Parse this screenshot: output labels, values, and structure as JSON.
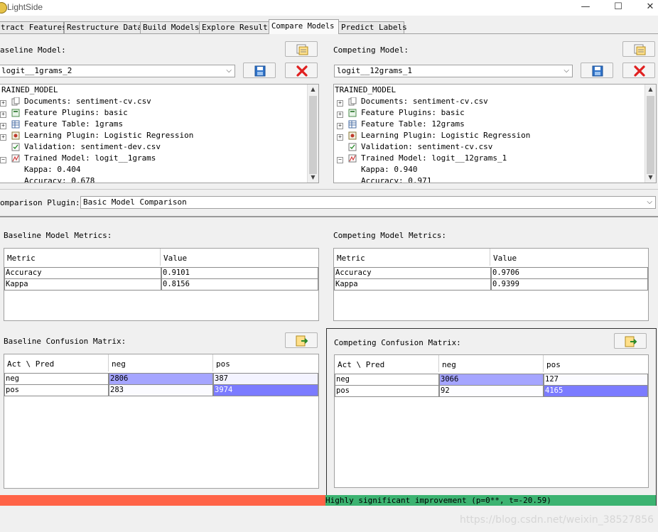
{
  "app": {
    "title": "LightSide"
  },
  "window_controls": {
    "minimize": "—",
    "maximize": "☐",
    "close": "✕"
  },
  "tabs": [
    {
      "label": "tract Features"
    },
    {
      "label": "Restructure Data"
    },
    {
      "label": "Build Models"
    },
    {
      "label": "Explore Results"
    },
    {
      "label": "Compare Models",
      "active": true
    },
    {
      "label": "Predict Labels"
    }
  ],
  "baseline": {
    "label": "aseline Model:",
    "selected_model": "logit__1grams_2",
    "tree": {
      "root": "RAINED_MODEL",
      "items": [
        {
          "text": "Documents: sentiment-cv.csv",
          "icon": "documents-icon"
        },
        {
          "text": "Feature Plugins: basic",
          "icon": "feature-plugins-icon"
        },
        {
          "text": "Feature Table: 1grams",
          "icon": "feature-table-icon"
        },
        {
          "text": "Learning Plugin:  Logistic Regression",
          "icon": "learning-plugin-icon"
        },
        {
          "text": "Validation: sentiment-dev.csv",
          "icon": "validation-icon"
        },
        {
          "text": "Trained Model: logit__1grams",
          "icon": "trained-model-icon"
        }
      ],
      "children": [
        "Kappa: 0.404",
        "Accuracy: 0.678"
      ]
    },
    "metrics_label": "Baseline Model Metrics:",
    "metrics_headers": [
      "Metric",
      "Value"
    ],
    "metrics": [
      {
        "name": "Accuracy",
        "value": "0.9101"
      },
      {
        "name": "Kappa",
        "value": "0.8156"
      }
    ],
    "confusion_label": "Baseline Confusion Matrix:",
    "confusion_headers": [
      "Act \\ Pred",
      "neg",
      "pos"
    ],
    "confusion": [
      {
        "act": "neg",
        "neg": "2806",
        "pos": "387"
      },
      {
        "act": "pos",
        "neg": "283",
        "pos": "3974"
      }
    ]
  },
  "competing": {
    "label": "Competing Model:",
    "selected_model": "logit__12grams_1",
    "tree": {
      "root": "TRAINED_MODEL",
      "items": [
        {
          "text": "Documents: sentiment-cv.csv",
          "icon": "documents-icon"
        },
        {
          "text": "Feature Plugins: basic",
          "icon": "feature-plugins-icon"
        },
        {
          "text": "Feature Table: 12grams",
          "icon": "feature-table-icon"
        },
        {
          "text": "Learning Plugin:  Logistic Regression",
          "icon": "learning-plugin-icon"
        },
        {
          "text": "Validation: sentiment-cv.csv",
          "icon": "validation-icon"
        },
        {
          "text": "Trained Model: logit__12grams_1",
          "icon": "trained-model-icon"
        }
      ],
      "children": [
        "Kappa: 0.940",
        "Accuracy: 0.971"
      ]
    },
    "metrics_label": "Competing Model Metrics:",
    "metrics_headers": [
      "Metric",
      "Value"
    ],
    "metrics": [
      {
        "name": "Accuracy",
        "value": "0.9706"
      },
      {
        "name": "Kappa",
        "value": "0.9399"
      }
    ],
    "confusion_label": "Competing Confusion Matrix:",
    "confusion_headers": [
      "Act \\ Pred",
      "neg",
      "pos"
    ],
    "confusion": [
      {
        "act": "neg",
        "neg": "3066",
        "pos": "127"
      },
      {
        "act": "pos",
        "neg": "92",
        "pos": "4165"
      }
    ]
  },
  "comparison": {
    "label": "omparison Plugin:",
    "selected": "Basic Model Comparison"
  },
  "status": {
    "text": "Highly significant improvement (p=0**, t=-20.59)"
  },
  "watermark": "https://blog.csdn.net/weixin_38527856",
  "colors": {
    "cell_light": "#a5a5ff",
    "cell_dark": "#7b7bff",
    "status_bad": "#ff6347",
    "status_good": "#3cb371"
  }
}
